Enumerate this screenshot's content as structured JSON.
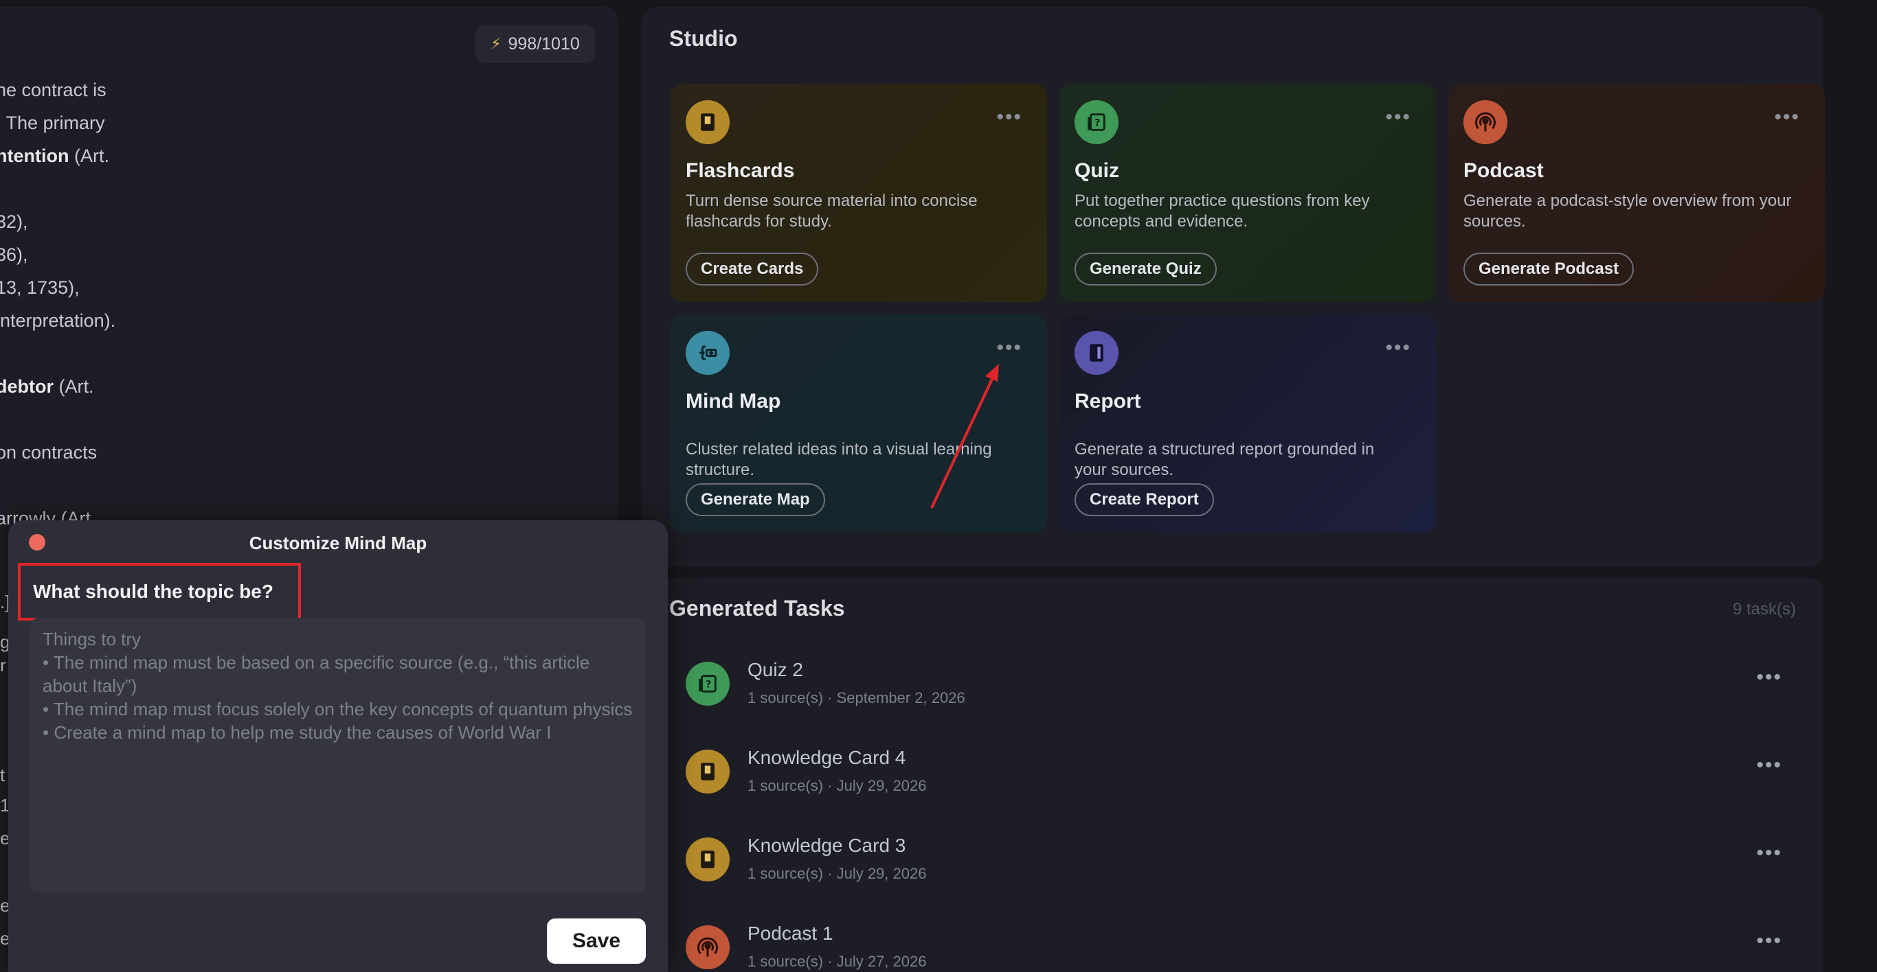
{
  "source_panel": {
    "token_badge": "998/1010",
    "lines": [
      {
        "text": "he contract is"
      },
      {
        "text": ". The primary"
      },
      {
        "bold": "ntention",
        "text": " (Art."
      },
      {
        "text": "32),"
      },
      {
        "text": "36),"
      },
      {
        "text": "13, 1735),"
      },
      {
        "text": "interpretation)."
      },
      {
        "bold": "debtor",
        "text": " (Art."
      },
      {
        "text": "on contracts"
      },
      {
        "text": "arrowly (Art."
      }
    ],
    "side_fragments": [
      ".]",
      "g",
      "r",
      "t",
      "1",
      "e",
      "e",
      "e"
    ]
  },
  "studio": {
    "title": "Studio",
    "cards": [
      {
        "title": "Flashcards",
        "desc": "Turn dense source material into concise flashcards for study.",
        "button": "Create Cards",
        "icon": "flashcard-icon",
        "color": "#b58a2a"
      },
      {
        "title": "Quiz",
        "desc": "Put together practice questions from key concepts and evidence.",
        "button": "Generate Quiz",
        "icon": "quiz-icon",
        "color": "#3f9a57"
      },
      {
        "title": "Podcast",
        "desc": "Generate a podcast-style overview from your sources.",
        "button": "Generate Podcast",
        "icon": "podcast-icon",
        "color": "#c25638"
      },
      {
        "title": "Mind Map",
        "desc": "Cluster related ideas into a visual learning structure.",
        "button": "Generate Map",
        "icon": "mind-map-icon",
        "color": "#3b8ea3"
      },
      {
        "title": "Report",
        "desc": "Generate a structured report grounded in your sources.",
        "button": "Create Report",
        "icon": "report-icon",
        "color": "#5a54ad"
      }
    ],
    "more_label": "•••"
  },
  "tasks": {
    "title": "Generated Tasks",
    "count": "9 task(s)",
    "items": [
      {
        "name": "Quiz 2",
        "meta": "1 source(s) · September 2, 2026",
        "icon": "quiz-icon"
      },
      {
        "name": "Knowledge Card 4",
        "meta": "1 source(s) · July 29, 2026",
        "icon": "flashcard-icon"
      },
      {
        "name": "Knowledge Card 3",
        "meta": "1 source(s) · July 29, 2026",
        "icon": "flashcard-icon"
      },
      {
        "name": "Podcast 1",
        "meta": "1 source(s) · July 27, 2026",
        "icon": "podcast-icon"
      }
    ]
  },
  "modal": {
    "title": "Customize Mind Map",
    "question": "What should the topic be?",
    "placeholder_lines": [
      "Things to try",
      "• The mind map must be based on a specific source (e.g., “this article about Italy”)",
      "• The mind map must focus solely on the key concepts of quantum physics",
      "• Create a mind map to help me study the causes of World War I"
    ],
    "save_label": "Save"
  },
  "colors": {
    "highlight": "#e0262b",
    "close_dot": "#ed6a5e",
    "annotation_arrow": "#e0262b"
  }
}
